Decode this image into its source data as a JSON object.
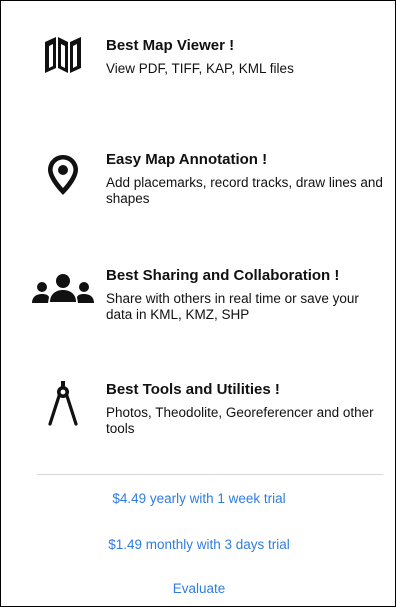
{
  "features": [
    {
      "title": "Best Map Viewer !",
      "description": "View PDF, TIFF, KAP, KML files",
      "icon": "map-icon"
    },
    {
      "title": "Easy Map Annotation !",
      "description": "Add placemarks, record tracks, draw lines and shapes",
      "icon": "placemark-pin-icon"
    },
    {
      "title": "Best Sharing and Collaboration !",
      "description": "Share with others in real time or save your data in KML, KMZ, SHP",
      "icon": "people-group-icon"
    },
    {
      "title": "Best Tools and Utilities !",
      "description": "Photos, Theodolite, Georeferencer and other tools",
      "icon": "compass-divider-icon"
    }
  ],
  "purchase": {
    "yearly_label": "$4.49 yearly with 1 week trial",
    "monthly_label": "$1.49 monthly with 3 days trial",
    "evaluate_label": "Evaluate"
  },
  "colors": {
    "accent": "#2f7de1",
    "text": "#111111",
    "divider": "#d6d6d6"
  }
}
